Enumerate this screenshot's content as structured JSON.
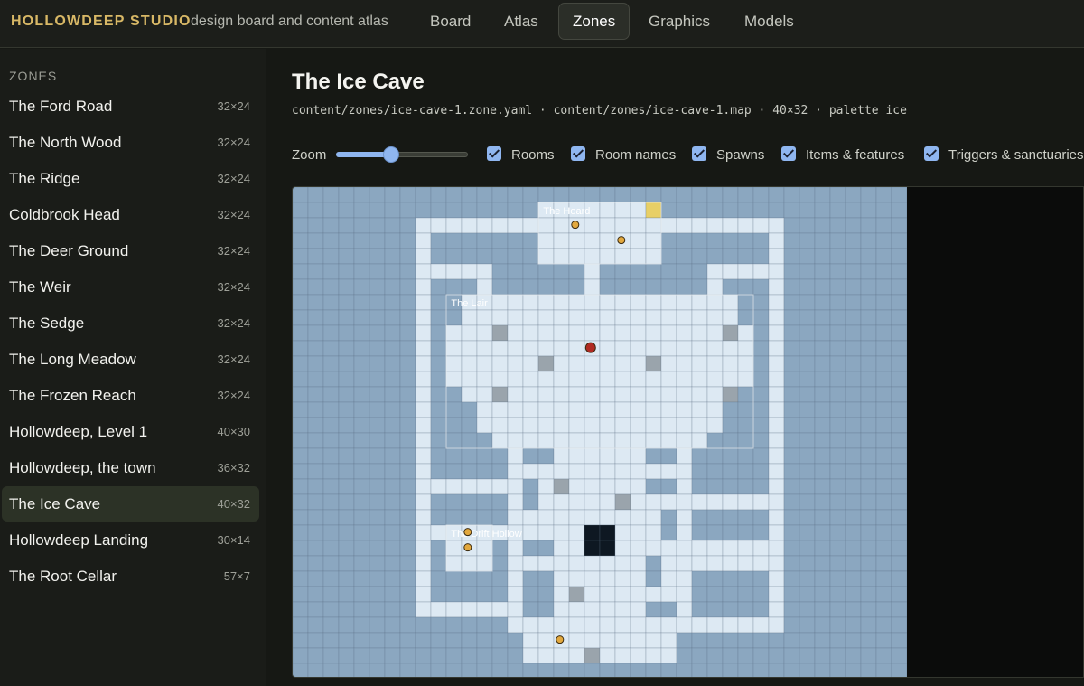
{
  "header": {
    "brand": "HOLLOWDEEP STUDIO",
    "tagline": "design board and content atlas",
    "tabs": [
      {
        "label": "Board",
        "active": false
      },
      {
        "label": "Atlas",
        "active": false
      },
      {
        "label": "Zones",
        "active": true
      },
      {
        "label": "Graphics",
        "active": false
      },
      {
        "label": "Models",
        "active": false
      }
    ]
  },
  "sidebar": {
    "heading": "ZONES",
    "items": [
      {
        "name": "The Ford Road",
        "size": "32×24",
        "active": false
      },
      {
        "name": "The North Wood",
        "size": "32×24",
        "active": false
      },
      {
        "name": "The Ridge",
        "size": "32×24",
        "active": false
      },
      {
        "name": "Coldbrook Head",
        "size": "32×24",
        "active": false
      },
      {
        "name": "The Deer Ground",
        "size": "32×24",
        "active": false
      },
      {
        "name": "The Weir",
        "size": "32×24",
        "active": false
      },
      {
        "name": "The Sedge",
        "size": "32×24",
        "active": false
      },
      {
        "name": "The Long Meadow",
        "size": "32×24",
        "active": false
      },
      {
        "name": "The Frozen Reach",
        "size": "32×24",
        "active": false
      },
      {
        "name": "Hollowdeep, Level 1",
        "size": "40×30",
        "active": false
      },
      {
        "name": "Hollowdeep, the town",
        "size": "36×32",
        "active": false
      },
      {
        "name": "The Ice Cave",
        "size": "40×32",
        "active": true
      },
      {
        "name": "Hollowdeep Landing",
        "size": "30×14",
        "active": false
      },
      {
        "name": "The Root Cellar",
        "size": "57×7",
        "active": false
      }
    ]
  },
  "zone": {
    "title": "The Ice Cave",
    "meta": "content/zones/ice-cave-1.zone.yaml · content/zones/ice-cave-1.map · 40×32 · palette ice"
  },
  "controls": {
    "zoom_label": "Zoom",
    "zoom_value": 0.42,
    "toggles": [
      {
        "label": "Rooms",
        "checked": true
      },
      {
        "label": "Room names",
        "checked": true
      },
      {
        "label": "Spawns",
        "checked": true
      },
      {
        "label": "Items & features",
        "checked": true
      },
      {
        "label": "Triggers & sanctuaries",
        "checked": true
      }
    ]
  },
  "map": {
    "colors": {
      "wall": "#8ba7c0",
      "floor": "#dde9f3",
      "grid": "#5b7085",
      "pillar": "#9aa4ac",
      "pit": "#0e1822",
      "gold": "#e8cf66",
      "item": "#e2a83e",
      "spawn": "#b02a22",
      "label": "#ffffff"
    },
    "room_labels": [
      "The Hoard",
      "The Lair",
      "The Drift Hollow"
    ]
  }
}
